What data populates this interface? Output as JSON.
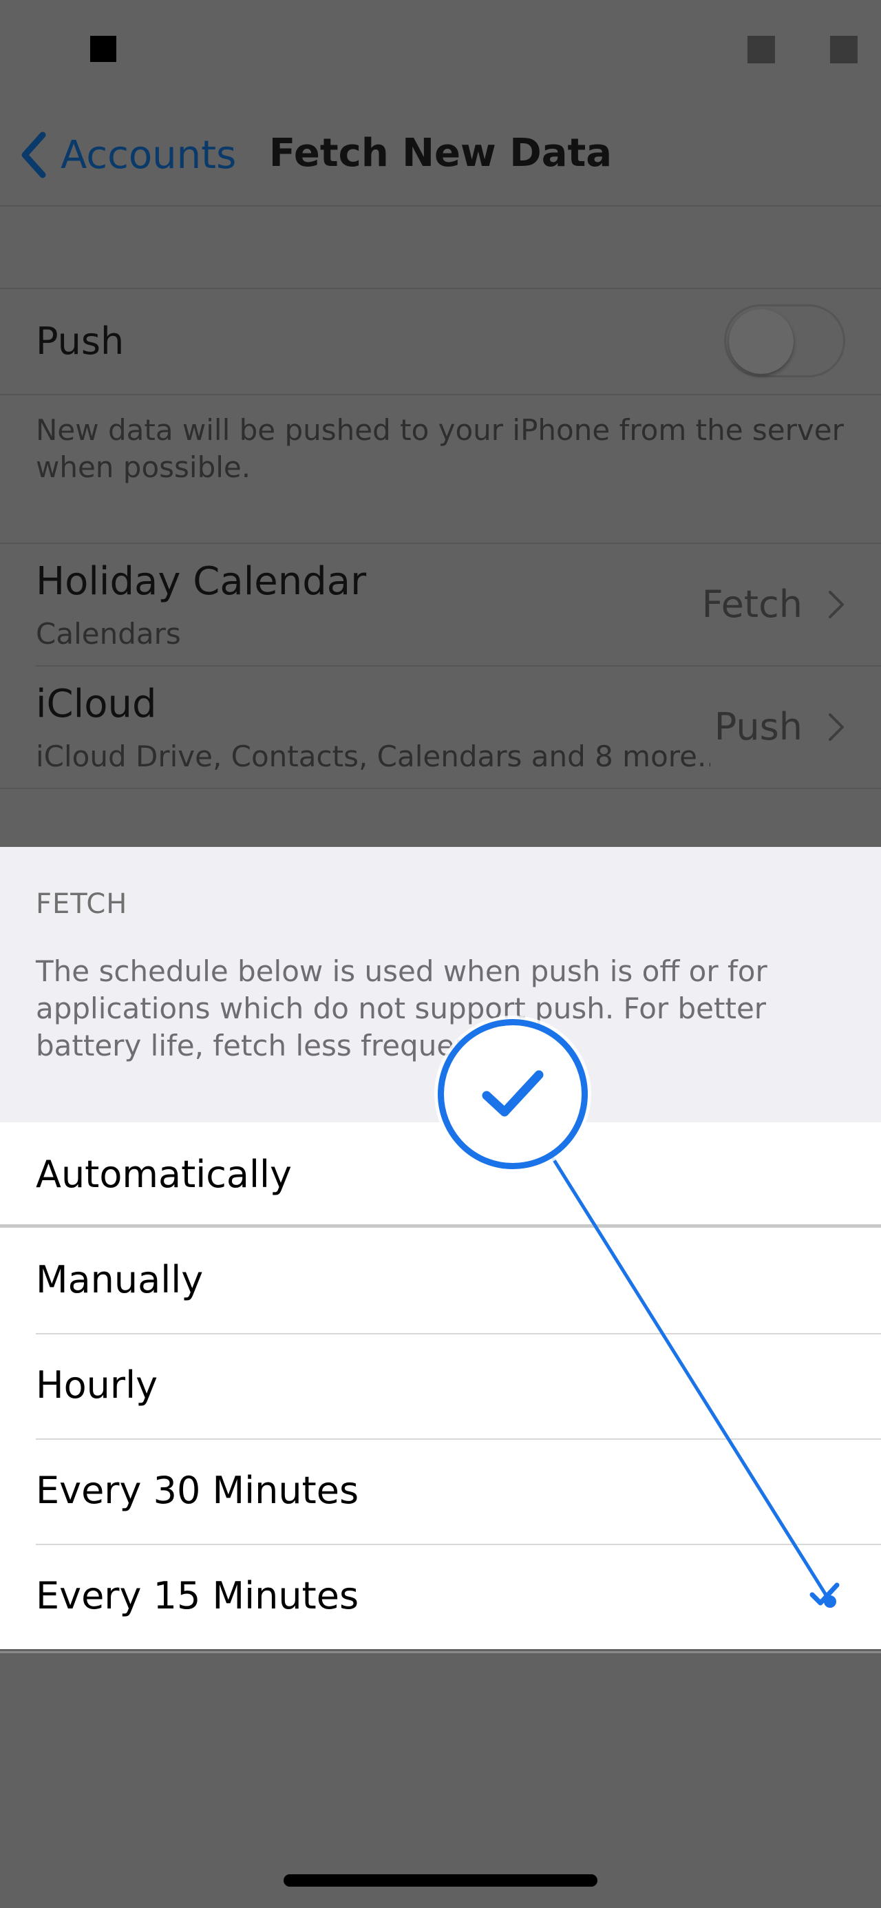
{
  "nav": {
    "back_label": "Accounts",
    "title": "Fetch New Data"
  },
  "push": {
    "label": "Push",
    "enabled": false,
    "description": "New data will be pushed to your iPhone from the server when possible."
  },
  "accounts": [
    {
      "name": "Holiday Calendar",
      "services": "Calendars",
      "mode": "Fetch"
    },
    {
      "name": "iCloud",
      "services": "iCloud Drive, Contacts, Calendars and 8 more...",
      "mode": "Push"
    }
  ],
  "fetch": {
    "section_label": "FETCH",
    "description": "The schedule below is used when push is off or for applications which do not support push. For better battery life, fetch less frequently.",
    "options": [
      {
        "label": "Automatically",
        "selected": false
      },
      {
        "label": "Manually",
        "selected": false
      },
      {
        "label": "Hourly",
        "selected": false
      },
      {
        "label": "Every 30 Minutes",
        "selected": false
      },
      {
        "label": "Every 15 Minutes",
        "selected": true
      }
    ]
  },
  "colors": {
    "accent": "#1a73e8",
    "dim_overlay": "#616161",
    "sheet_background": "#efeff4"
  },
  "icons": {
    "back": "chevron-left-icon",
    "disclosure": "chevron-right-icon",
    "selected": "checkmark-icon"
  }
}
